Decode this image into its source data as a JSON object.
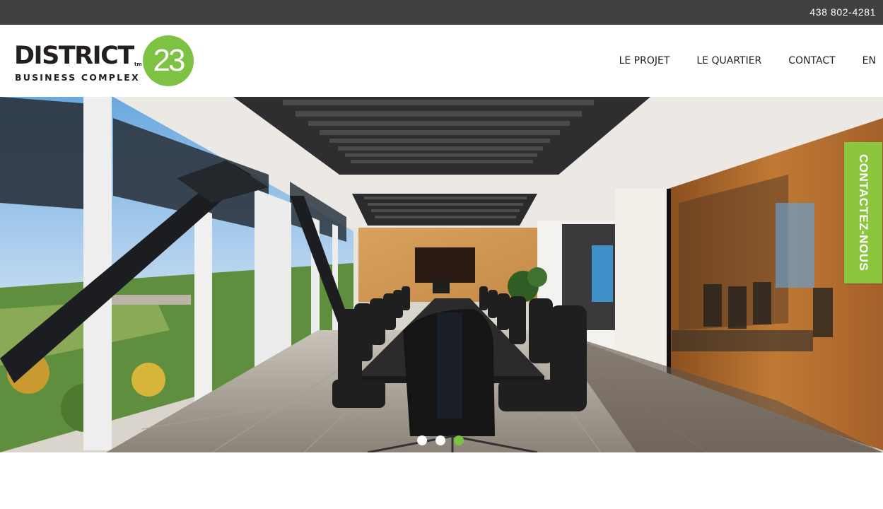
{
  "topbar": {
    "phone": "438 802-4281"
  },
  "logo": {
    "wordmark": "DISTRICT",
    "tm": "tm",
    "number": "23",
    "subtitle": "BUSINESS COMPLEX",
    "circle_color": "#7dc242"
  },
  "nav": {
    "items": [
      {
        "label": "LE PROJET"
      },
      {
        "label": "LE QUARTIER"
      },
      {
        "label": "CONTACT"
      },
      {
        "label": "EN"
      }
    ]
  },
  "hero": {
    "image_subject": "boardroom-photo",
    "slide_count": 3,
    "active_slide": 3
  },
  "side_tab": {
    "label": "CONTACTEZ-NOUS",
    "color": "#8cc63f"
  },
  "colors": {
    "topbar": "#414042",
    "accent": "#7dc242"
  }
}
